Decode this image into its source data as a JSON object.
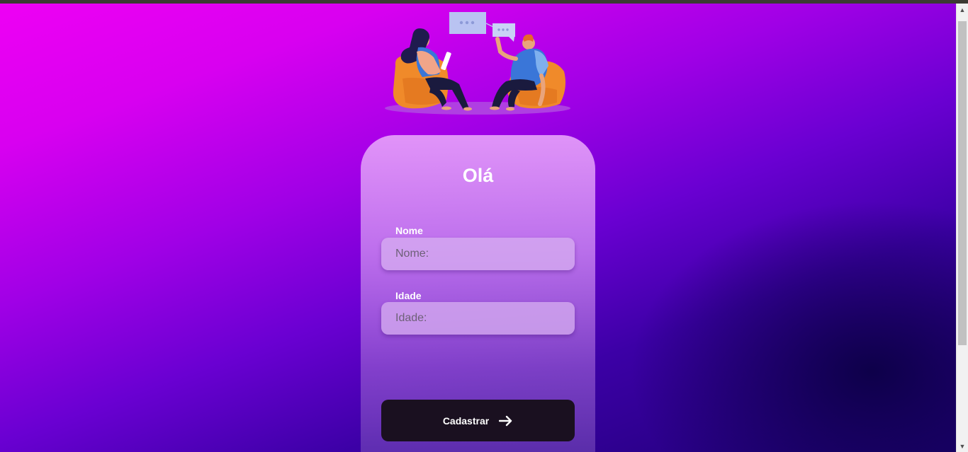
{
  "card": {
    "title": "Olá",
    "fields": [
      {
        "label": "Nome",
        "placeholder": "Nome:",
        "value": ""
      },
      {
        "label": "Idade",
        "placeholder": "Idade:",
        "value": ""
      }
    ],
    "submit_label": "Cadastrar"
  },
  "icons": {
    "submit": "arrow-right-icon",
    "illustration": "conversation-illustration"
  },
  "colors": {
    "gradient_start": "#ee00f4",
    "gradient_end": "#1c0072",
    "button": "#1a1020",
    "text": "#ffffff"
  }
}
